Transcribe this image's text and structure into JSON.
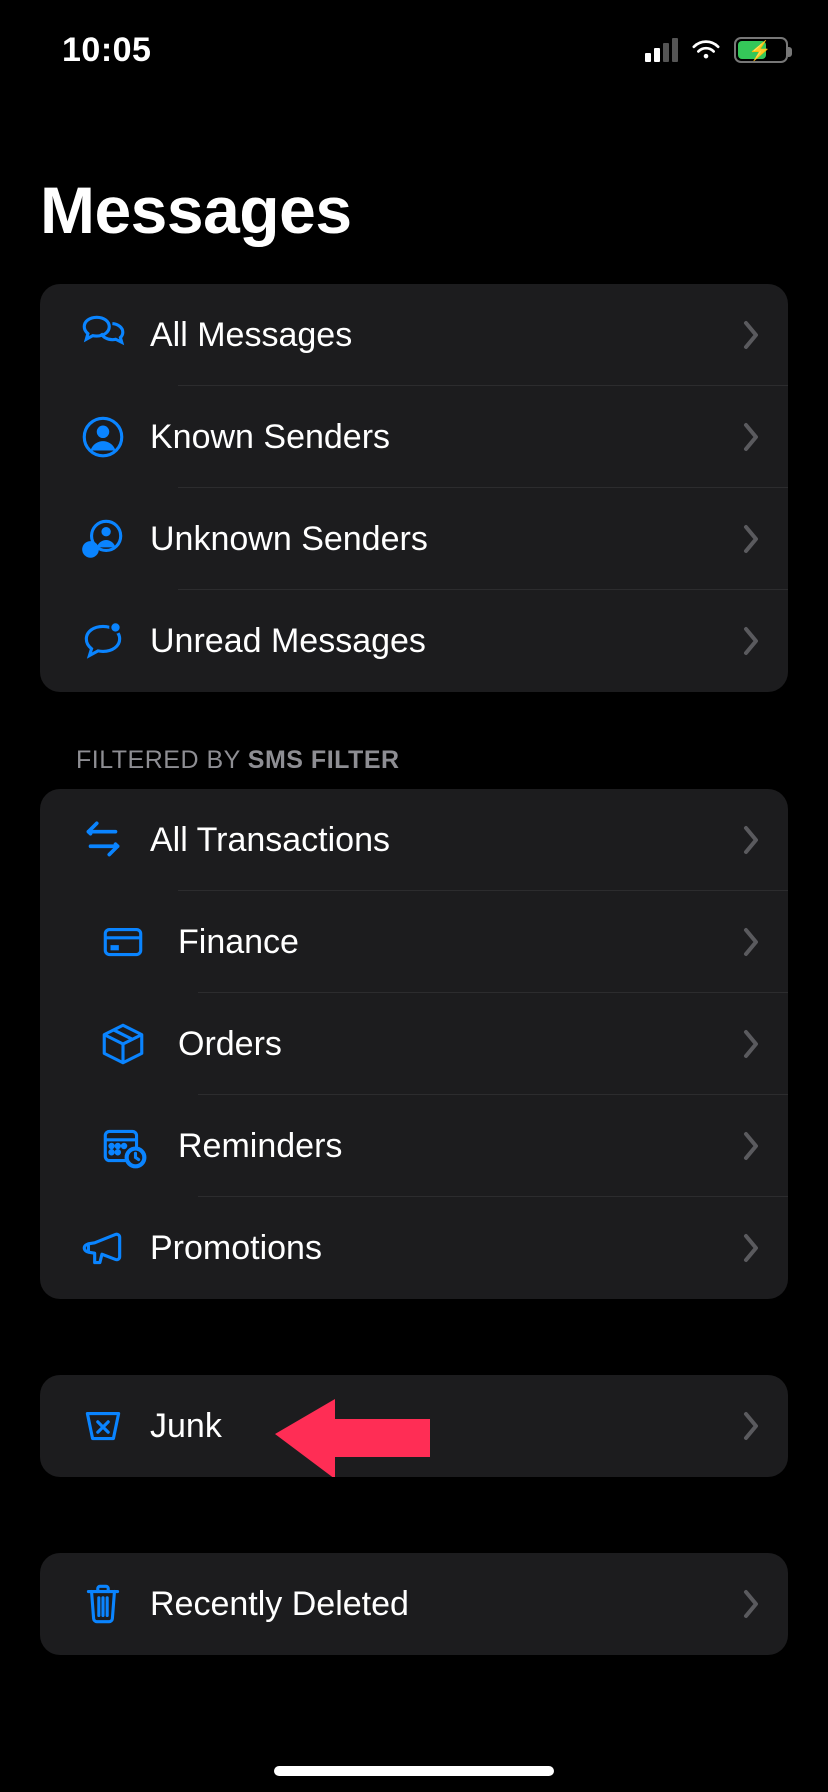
{
  "status": {
    "time": "10:05",
    "cell_signal_bars_active": 2,
    "cell_signal_bars_total": 4,
    "wifi_level": 3,
    "battery_charging": true,
    "battery_percent_approx": 55,
    "battery_fill_color": "#35c759"
  },
  "title": "Messages",
  "accent_color": "#0a84ff",
  "groups": {
    "main": [
      {
        "id": "all-messages",
        "icon": "chat-bubbles-icon",
        "label": "All Messages"
      },
      {
        "id": "known-senders",
        "icon": "person-circle-icon",
        "label": "Known Senders"
      },
      {
        "id": "unknown-senders",
        "icon": "person-question-icon",
        "label": "Unknown Senders"
      },
      {
        "id": "unread-messages",
        "icon": "chat-bubble-dot-icon",
        "label": "Unread Messages"
      }
    ],
    "filter_header_prefix": "FILTERED BY ",
    "filter_header_name": "SMS FILTER",
    "filtered": [
      {
        "id": "all-transactions",
        "icon": "arrows-swap-icon",
        "label": "All Transactions",
        "indent": false
      },
      {
        "id": "finance",
        "icon": "credit-card-icon",
        "label": "Finance",
        "indent": true
      },
      {
        "id": "orders",
        "icon": "package-box-icon",
        "label": "Orders",
        "indent": true
      },
      {
        "id": "reminders",
        "icon": "calendar-clock-icon",
        "label": "Reminders",
        "indent": true
      },
      {
        "id": "promotions",
        "icon": "megaphone-icon",
        "label": "Promotions",
        "indent": false
      }
    ],
    "junk": {
      "id": "junk",
      "icon": "junk-bin-icon",
      "label": "Junk"
    },
    "recently_deleted": {
      "id": "recently-deleted",
      "icon": "trash-icon",
      "label": "Recently Deleted"
    }
  },
  "annotation": {
    "type": "arrow",
    "color": "#ff2d55",
    "points_to_row_id": "junk",
    "direction": "left"
  }
}
